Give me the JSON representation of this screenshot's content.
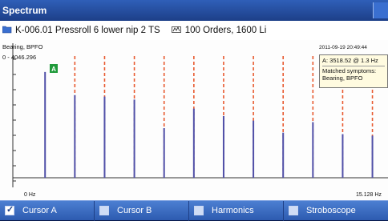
{
  "window": {
    "title": "Spectrum"
  },
  "info": {
    "folder_icon": "folder-icon",
    "measurement": "K-006.01 Pressroll 6 lower nip 2 TS",
    "orders_icon": "spectrum-settings-icon",
    "orders": "100 Orders, 1600 Li"
  },
  "plot": {
    "fault_label": "Bearing, BPFO",
    "amplitude_range": "0 - 4046.296",
    "marker_label": "A",
    "timestamp": "2011-09-19 20:49:44",
    "x_start": "0 Hz",
    "x_end": "15.128 Hz"
  },
  "tooltip": {
    "cursor_value": "A: 3518.52 @ 1.3 Hz",
    "matched_label": "Matched symptoms:",
    "matched_value": "Bearing, BPFO"
  },
  "toolbar": {
    "cursor_a": "Cursor A",
    "cursor_b": "Cursor B",
    "harmonics": "Harmonics",
    "stroboscope": "Stroboscope"
  },
  "colors": {
    "peak": "#5050a8",
    "harmonic_marker": "#e85a30",
    "cursor_marker": "#1f9a3a"
  },
  "chart_data": {
    "type": "bar",
    "xlim": [
      0,
      15.128
    ],
    "ylim": [
      0,
      4046.296
    ],
    "x": [
      1.3,
      2.5,
      3.7,
      4.9,
      6.1,
      7.3,
      8.5,
      9.7,
      10.9,
      12.1,
      13.3,
      14.5
    ],
    "values": [
      3518.52,
      2750,
      2700,
      2600,
      1650,
      2300,
      2050,
      1900,
      1500,
      1850,
      1450,
      1400
    ]
  }
}
